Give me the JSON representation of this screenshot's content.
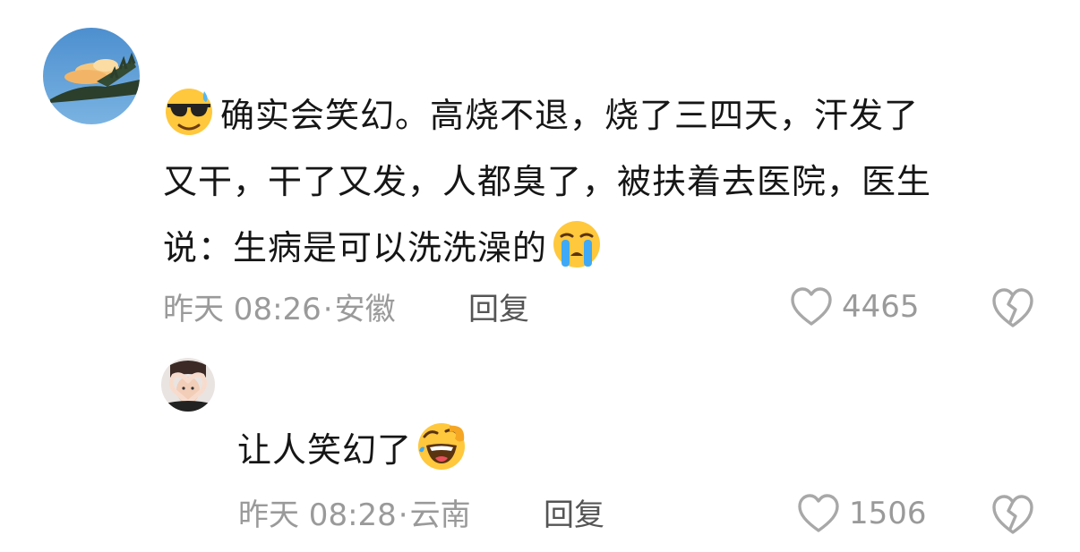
{
  "comment": {
    "avatar_icon": "cloud-sky-avatar",
    "lead_emoji": "sunglasses-sweat-emoji",
    "lines": [
      "确实会笑幻。高烧不退，烧了三四天，汗发了",
      "又干，干了又发，人都臭了，被扶着去医院，医生",
      "说：生病是可以洗洗澡的"
    ],
    "tail_emoji": "loudly-crying-emoji",
    "time": "昨天 08:26",
    "separator": "·",
    "location": "安徽",
    "reply_label": "回复",
    "like_count": "4465"
  },
  "reply": {
    "avatar_icon": "heart-hands-avatar",
    "text": "让人笑幻了",
    "tail_emoji": "rolling-laughing-emoji",
    "time": "昨天 08:28",
    "separator": "·",
    "location": "云南",
    "reply_label": "回复",
    "like_count": "1506"
  },
  "colors": {
    "text": "#161616",
    "meta": "#9a9a9a",
    "reply_button": "#555555",
    "icon_outline": "#a8a8a8",
    "emoji_yellow": "#ffc83d"
  }
}
